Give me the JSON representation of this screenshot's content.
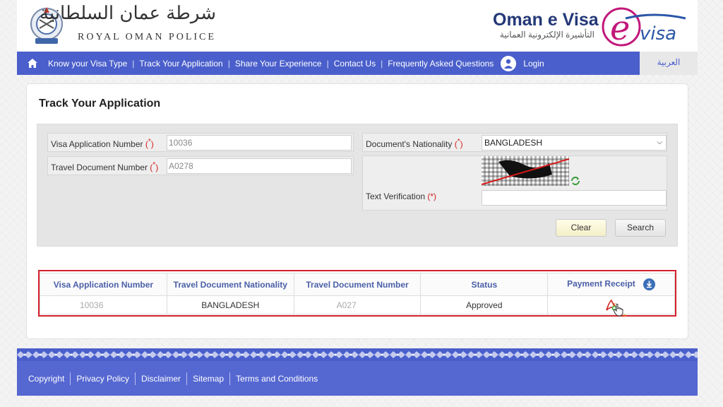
{
  "header": {
    "rop_arabic": "شرطة عمان السلطانية",
    "rop_english": "ROYAL OMAN POLICE",
    "evisa_title": "Oman e Visa",
    "evisa_arabic": "التأشيرة الإلكترونية العمانية",
    "logo_text": "e visa"
  },
  "nav": {
    "items": [
      {
        "label": "Know your Visa Type"
      },
      {
        "label": "Track Your Application"
      },
      {
        "label": "Share Your Experience"
      },
      {
        "label": "Contact Us"
      },
      {
        "label": "Frequently Asked Questions"
      }
    ],
    "login": "Login",
    "language": "العربية"
  },
  "page": {
    "title": "Track Your Application"
  },
  "form": {
    "visa_app_label": "Visa Application Number",
    "visa_app_value": "10036",
    "travel_doc_label": "Travel Document Number",
    "travel_doc_value": "A0278",
    "nationality_label": "Document's Nationality",
    "nationality_value": "BANGLADESH",
    "text_verification_label": "Text Verification",
    "required_mark": "(*)",
    "required_mark_small": "(",
    "captcha_value": "",
    "clear_label": "Clear",
    "search_label": "Search"
  },
  "results": {
    "headers": [
      "Visa Application Number",
      "Travel Document Nationality",
      "Travel Document Number",
      "Status",
      "Payment Receipt"
    ],
    "row": {
      "visa_app_number": "10036",
      "nationality": "BANGLADESH",
      "travel_doc_number": "A027",
      "status": "Approved"
    }
  },
  "footer": {
    "links": [
      "Copyright",
      "Privacy Policy",
      "Disclaimer",
      "Sitemap",
      "Terms and Conditions"
    ]
  },
  "colors": {
    "nav_bg": "#4a5fcb",
    "header_text": "#4a5fa8",
    "highlight_border": "#d3202c",
    "logo_magenta": "#c2177a"
  },
  "icons": [
    "home-icon",
    "user-icon",
    "refresh-icon",
    "download-icon",
    "pdf-icon",
    "hand-cursor-icon"
  ]
}
